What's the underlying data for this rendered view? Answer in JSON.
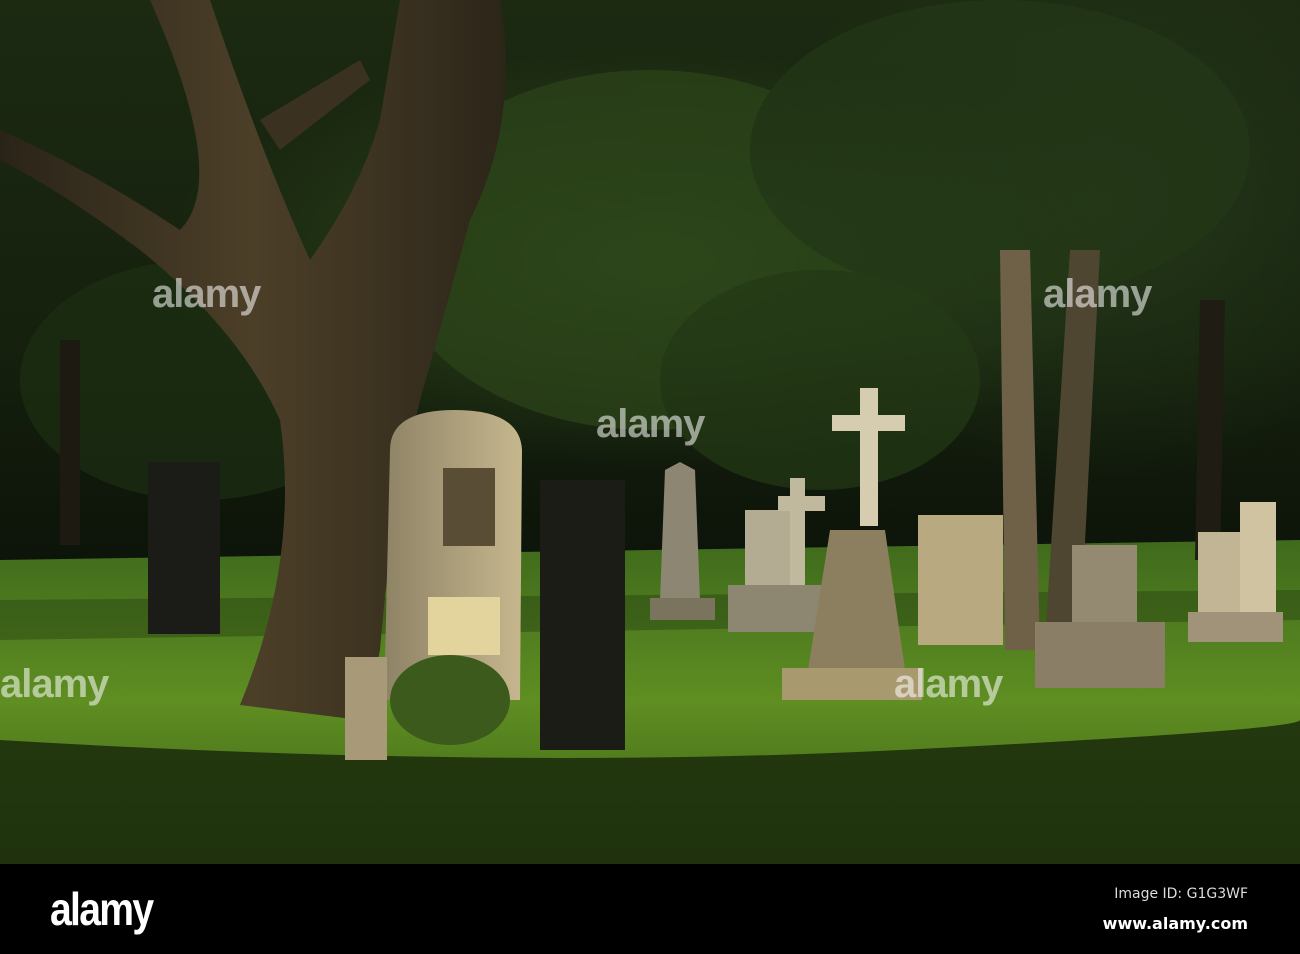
{
  "watermark": {
    "text": "alamy"
  },
  "footer": {
    "logo": "alamy",
    "image_id": "Image ID: G1G3WF",
    "url": "www.alamy.com"
  }
}
